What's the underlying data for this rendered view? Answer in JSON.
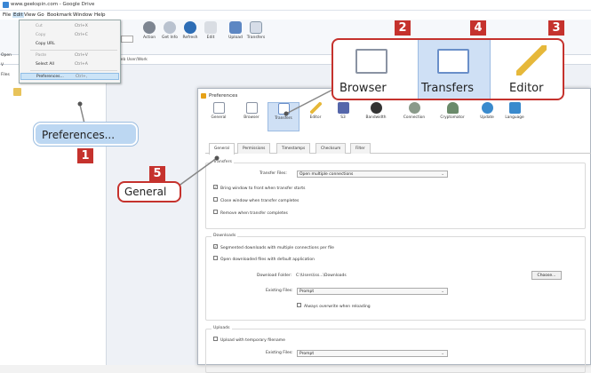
{
  "window": {
    "title": "www.geekspin.com - Google Drive"
  },
  "menubar": [
    "File",
    "Edit",
    "View",
    "Go",
    "Bookmark",
    "Window",
    "Help"
  ],
  "toolbar": {
    "items": [
      "Action",
      "Get Info",
      "Refresh",
      "Edit",
      "Upload",
      "Transfers"
    ]
  },
  "pathbar": {
    "text": "My Drive/Web User/Work"
  },
  "sidebar": {
    "labels": [
      "Open",
      "V",
      "Files",
      ""
    ]
  },
  "edit_menu": {
    "items": [
      {
        "label": "Cut",
        "shortcut": "Ctrl+X",
        "disabled": true
      },
      {
        "label": "Copy",
        "shortcut": "Ctrl+C",
        "disabled": true
      },
      {
        "label": "Copy URL",
        "shortcut": "",
        "disabled": false
      },
      {
        "label": "Paste",
        "shortcut": "Ctrl+V",
        "disabled": true
      },
      {
        "label": "Select All",
        "shortcut": "Ctrl+A",
        "disabled": false
      },
      {
        "label": "Preferences...",
        "shortcut": "Ctrl+,",
        "disabled": false
      }
    ]
  },
  "prefs": {
    "title": "Preferences",
    "categories": [
      {
        "label": "General",
        "color": "#8a93a3"
      },
      {
        "label": "Browser",
        "color": "#8a93a3"
      },
      {
        "label": "Transfers",
        "color": "#6a8fc9"
      },
      {
        "label": "Editor",
        "color": "#e6b83a"
      },
      {
        "label": "S3",
        "color": "#5566aa"
      },
      {
        "label": "Bandwidth",
        "color": "#333333"
      },
      {
        "label": "Connection",
        "color": "#8a9a8a"
      },
      {
        "label": "Cryptomator",
        "color": "#6a8a6a"
      },
      {
        "label": "Update",
        "color": "#3a8acd"
      },
      {
        "label": "Language",
        "color": "#3a8acd"
      }
    ],
    "selected_category": "Transfers",
    "tabs": [
      "General",
      "Permissions",
      "Timestamps",
      "Checksum",
      "Filter"
    ],
    "selected_tab": "General",
    "transfers": {
      "heading": "Transfers",
      "files_label": "Transfer Files:",
      "files_value": "Open multiple connections",
      "options": [
        {
          "label": "Bring window to front when transfer starts",
          "checked": true
        },
        {
          "label": "Close window when transfer completes",
          "checked": false
        },
        {
          "label": "Remove when transfer completes",
          "checked": false
        }
      ]
    },
    "downloads": {
      "heading": "Downloads",
      "options": [
        {
          "label": "Segmented downloads with multiple connections per file",
          "checked": true
        },
        {
          "label": "Open downloaded files with default application",
          "checked": false
        }
      ],
      "folder_label": "Download Folder:",
      "folder_value": "C:\\Users\\iss...\\Downloads",
      "choose_button": "Choose...",
      "existing_label": "Existing Files:",
      "existing_value": "Prompt",
      "always_overwrite": "Always overwrite when reloading"
    },
    "uploads": {
      "heading": "Uploads",
      "temp_option": "Upload with temporary filename",
      "existing_label": "Existing Files:",
      "existing_value": "Prompt"
    }
  },
  "zoom_callout": {
    "items": [
      "Browser",
      "Transfers",
      "Editor"
    ]
  },
  "callouts": {
    "preferences": {
      "text": "Preferences...",
      "number": "1"
    },
    "browser_num": "2",
    "editor_num": "3",
    "transfers_num": "4",
    "general": {
      "text": "General",
      "number": "5"
    }
  }
}
